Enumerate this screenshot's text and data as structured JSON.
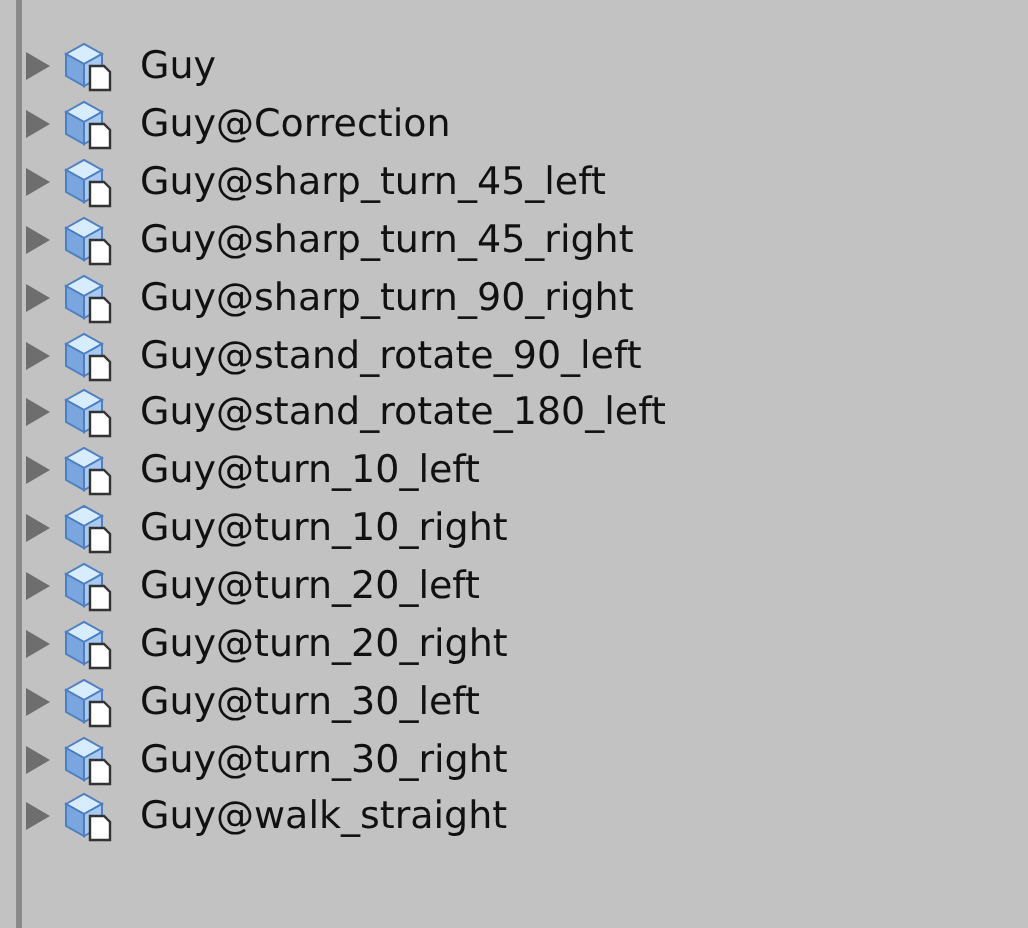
{
  "items": [
    {
      "label": "Guy",
      "expanded": false
    },
    {
      "label": "Guy@Correction",
      "expanded": false
    },
    {
      "label": "Guy@sharp_turn_45_left",
      "expanded": false
    },
    {
      "label": "Guy@sharp_turn_45_right",
      "expanded": false
    },
    {
      "label": "Guy@sharp_turn_90_right",
      "expanded": false
    },
    {
      "label": "Guy@stand_rotate_90_left",
      "expanded": false
    },
    {
      "label": "Guy@stand_rotate_180_left",
      "expanded": false
    },
    {
      "label": "Guy@turn_10_left",
      "expanded": false
    },
    {
      "label": "Guy@turn_10_right",
      "expanded": false
    },
    {
      "label": "Guy@turn_20_left",
      "expanded": false
    },
    {
      "label": "Guy@turn_20_right",
      "expanded": false
    },
    {
      "label": "Guy@turn_30_left",
      "expanded": false
    },
    {
      "label": "Guy@turn_30_right",
      "expanded": false
    },
    {
      "label": "Guy@walk_straight",
      "expanded": false
    }
  ]
}
